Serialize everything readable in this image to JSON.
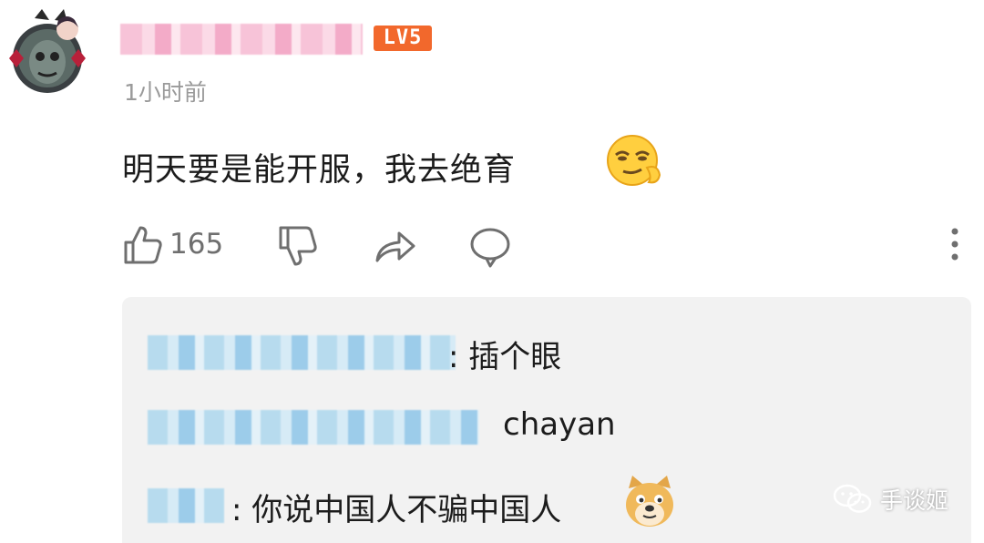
{
  "comment": {
    "user": {
      "level_badge": "LV5"
    },
    "timestamp": "1小时前",
    "text": "明天要是能开服，我去绝育",
    "emoji": "smirk-emoji",
    "actions": {
      "like_count": "165",
      "icons": [
        "thumbs-up-icon",
        "thumbs-down-icon",
        "share-icon",
        "reply-icon",
        "more-icon"
      ]
    }
  },
  "replies": [
    {
      "text": ": 插个眼"
    },
    {
      "text": "chayan"
    },
    {
      "text": ": 你说中国人不骗中国人",
      "emoji": "doge-emoji"
    }
  ],
  "watermark": {
    "text": "手谈姬",
    "icon": "wechat-icon"
  },
  "colors": {
    "level_badge": "#f2682c",
    "timestamp": "#9a9a9a",
    "reply_background": "#f2f2f2",
    "name_blur_pink": "#f7c0d6",
    "name_blur_blue": "#b7dbee"
  }
}
